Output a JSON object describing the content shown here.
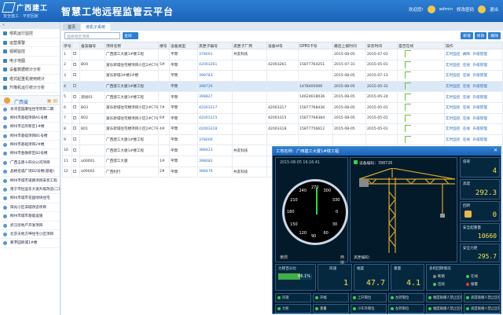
{
  "header": {
    "logo_text": "广西建工",
    "slogan": "安全施工 · 平安回家",
    "title": "智慧工地远程监管云平台",
    "welcome": "欢迎您!",
    "user": "admin",
    "pwd": "修改密码",
    "logout": "退出"
  },
  "sidebar": {
    "collapse": "«",
    "items": [
      "塔机运行监控",
      "运营报警",
      "视频监控",
      "电子地图",
      "设备数据统计分析",
      "塔式起重机使用统计",
      "升降机运行统计分析"
    ],
    "region_title": "广西省",
    "region_tools": "▣ ▤",
    "projects": [
      "龙湾苗园康恒住宅项目二期",
      "柳州市基础项目A1号楼",
      "柳州市沿岸新区1#楼",
      "柳州市基础项目B1号楼",
      "柳州市基础项目2#楼",
      "柳州市金融新区B2号楼",
      "广西五建十四分公司项目",
      "晶格名城广场D2号楼(基础)",
      "柳州市城市道路项目安装工程",
      "南宁市恒运东大道升级改造(二期)",
      "柳州市城市花园地块住宅",
      "阳光小区旧城改造项目",
      "柳州市城市基础设施",
      "武汉房地产开发项目",
      "北京天地方坤住宅小区项目",
      "蕉芋园新城1#楼"
    ]
  },
  "tabs": [
    "首页",
    "塔机子系统"
  ],
  "toolbar": {
    "search_placeholder": "选择地区项目",
    "query": "查询",
    "add": "新增",
    "edit": "修改",
    "delete": "删除"
  },
  "table": {
    "headers": [
      "序号",
      "",
      "备案编号",
      "项目名称",
      "楼号",
      "设备类型",
      "黑匣子编号",
      "黑匣子厂商",
      "设备id号",
      "GPRS卡号",
      "最后上报时间",
      "安装时间",
      "是否在线",
      "操作"
    ],
    "rows": [
      [
        "1",
        "",
        "",
        "广西建工大厦1#楼工程",
        "",
        "平臂",
        "378001",
        "共友科技",
        "",
        "",
        "2015-08-05",
        "2015-07-03",
        "",
        "实时监控 故障 升级管理"
      ],
      [
        "2",
        "",
        "B04",
        "富乐新城住宅楼项目小区2#C7号楼",
        "5#",
        "平臂",
        "42003261",
        "",
        "42003261",
        "15877764251",
        "2015-07-31",
        "2015-05-01",
        "",
        "实时监控 在线 升级管理"
      ],
      [
        "3",
        "",
        "",
        "富乐新城3#楼2#楼",
        "",
        "平臂",
        "398783",
        "",
        "",
        "",
        "2015-08-05",
        "2015-07-13",
        "",
        "实时监控 在线 升级管理"
      ],
      [
        "4",
        "",
        "",
        "广西建工大厦1#楼工程",
        "",
        "平臂",
        "398726",
        "",
        "",
        "1478405006",
        "2015-08-05",
        "2015-05-31",
        "",
        "实时监控 在线 升级管理"
      ],
      [
        "5",
        "",
        "测试01",
        "广西建工大厦1#楼工程",
        "",
        "平臂",
        "398827",
        "",
        "",
        "14624618036",
        "2015-08-05",
        "2015-05-24",
        "",
        "实时监控 在线 升级管理"
      ],
      [
        "6",
        "",
        "B03",
        "富乐新城住宅楼项目小区2#C7号楼",
        "7#",
        "平臂",
        "42003317",
        "",
        "42003317",
        "15877768436",
        "2015-08-05",
        "2015-05-01",
        "",
        "实时监控 在线 升级管理"
      ],
      [
        "7",
        "",
        "B02",
        "富乐新城住宅楼项目小区2#C7号楼",
        "6#",
        "平臂",
        "42003315",
        "",
        "42003315",
        "15877768384",
        "2015-08-05",
        "2015-05-01",
        "",
        "实时监控 在线 升级管理"
      ],
      [
        "8",
        "",
        "B01",
        "富乐新城住宅楼项目小区2#C7号楼",
        "4#",
        "平臂",
        "42003318",
        "",
        "42003318",
        "15877756612",
        "2015-08-05",
        "2015-05-01",
        "",
        "实时监控 在线 升级管理"
      ],
      [
        "9",
        "",
        "",
        "广西建工大厦1#楼工程",
        "",
        "平臂",
        "378000",
        "",
        "",
        "",
        "",
        "",
        "",
        "实时监控 在线 升级管理"
      ],
      [
        "10",
        "",
        "",
        "广西建工大厦1#楼工程",
        "",
        "平臂",
        "398423",
        "共友科技",
        "",
        "",
        "",
        "",
        "",
        "实时监控 在线 升级管理"
      ],
      [
        "11",
        "",
        "a00001",
        "广西建工大厦",
        "1#",
        "平臂",
        "398482",
        "",
        "",
        "",
        "",
        "",
        "",
        "实时监控 在线 升级管理"
      ],
      [
        "12",
        "",
        "a00002",
        "广西利行",
        "2#",
        "平臂",
        "398476",
        "共友科技",
        "",
        "",
        "",
        "",
        "",
        "实时监控 在线 升级管理"
      ]
    ]
  },
  "popup": {
    "title": "工地名称：广西建工大厦1#楼工程",
    "close": "✕",
    "datetime": "2015-08-05 16:16:41",
    "gauge_labels": [
      "270",
      "300",
      "330",
      "0",
      "30",
      "60",
      "90",
      "120",
      "150",
      "180",
      "210",
      "240"
    ],
    "gauge_left": "東侧",
    "gauge_right": "西侧",
    "device_label": "设备编码：398726",
    "device_label2": "黑匣编码：",
    "right_cards": [
      {
        "label": "倍率",
        "value": "4"
      },
      {
        "label": "高度",
        "value": "292.3"
      },
      {
        "label": "回转",
        "value": "0"
      },
      {
        "label": "安全起重量",
        "value": "10660"
      },
      {
        "label": "安全力矩",
        "value": "295.7"
      }
    ],
    "torque_pct": {
      "label": "力矩百分比",
      "value": "66.1%",
      "fraction": 0.661
    },
    "wind": {
      "label": "风速",
      "value": "1"
    },
    "range": {
      "label": "幅度",
      "value": "47.7"
    },
    "weight": {
      "label": "重量",
      "value": "4.1"
    },
    "status": {
      "label": "多机回转情况",
      "items": [
        "断路",
        "在线",
        "连续",
        "报警"
      ]
    },
    "alarms": [
      "风速",
      "开幅",
      "上升限位",
      "左转限位",
      "幅度碰撞人禁止区域",
      "高度碰撞人禁止区域",
      "力矩",
      "重量",
      "小车外限位",
      "左转限位",
      "幅度碰撞人禁止区域",
      "高度碰撞人禁止区域"
    ]
  },
  "colors": {
    "header": "#1b63b8",
    "accent": "#2d7fd3",
    "highlight": "#f8e14a"
  }
}
